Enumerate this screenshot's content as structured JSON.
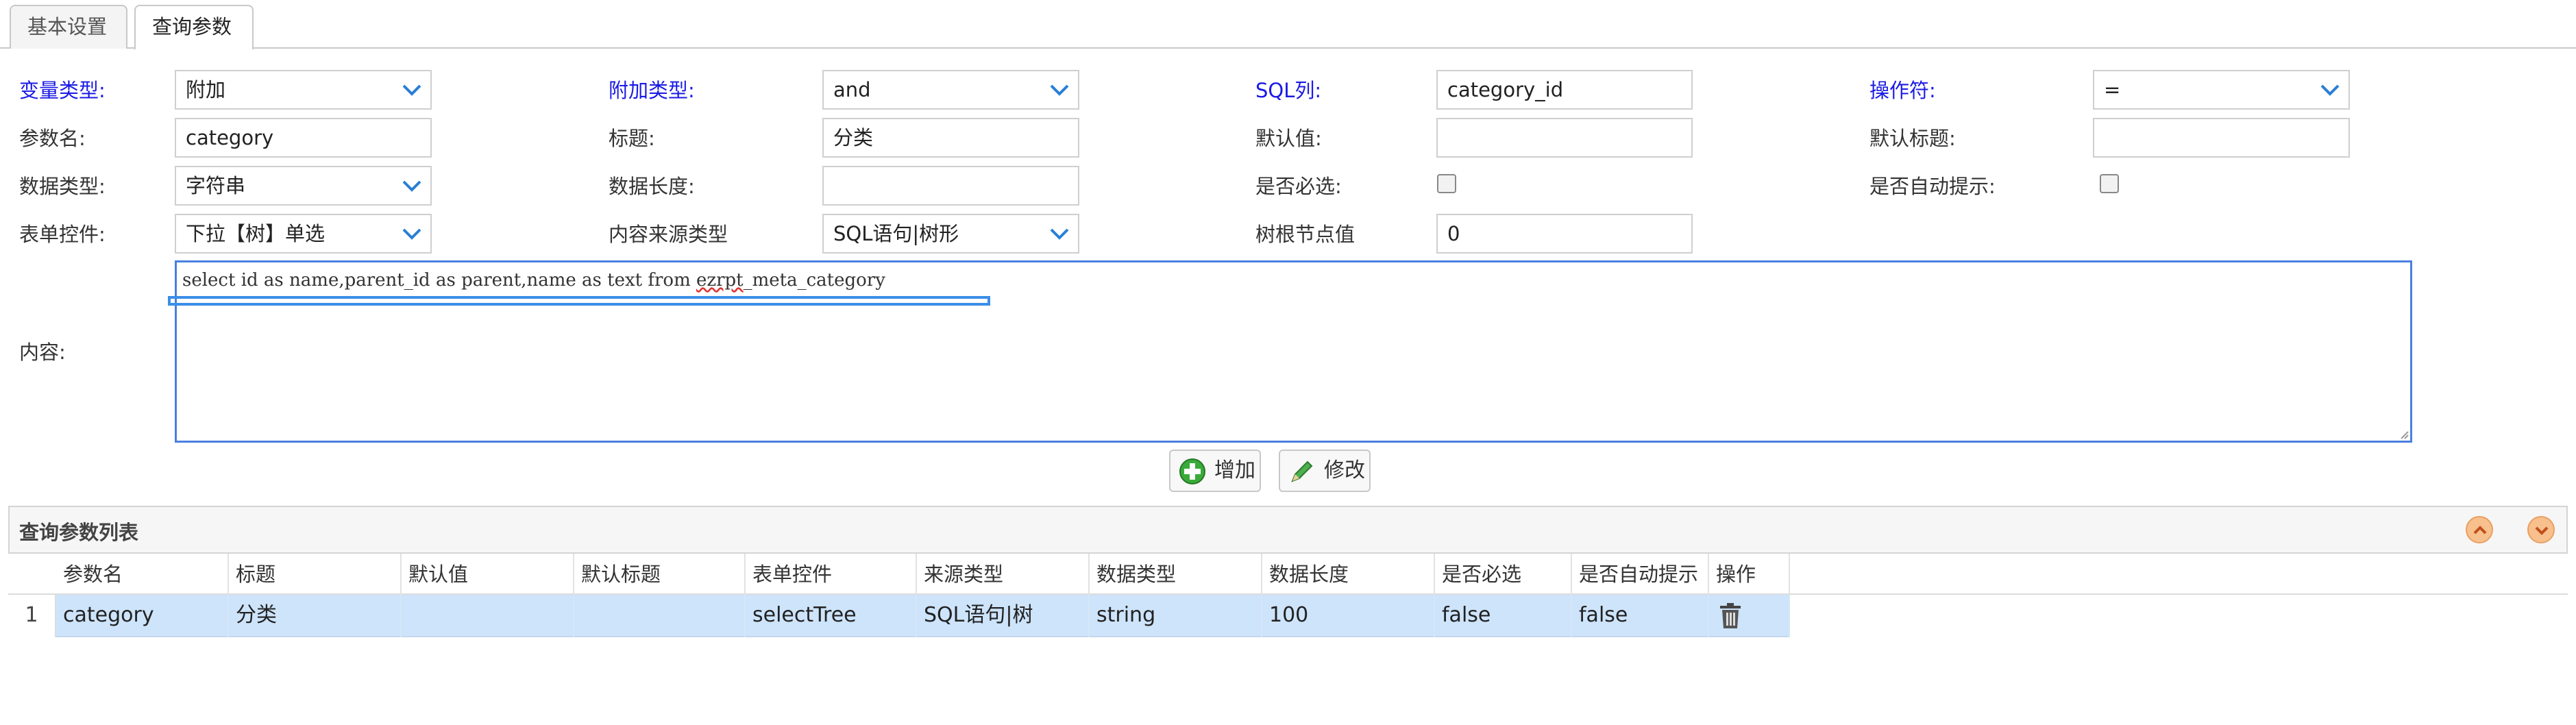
{
  "tabs": [
    {
      "label": "基本设置",
      "active": false
    },
    {
      "label": "查询参数",
      "active": true
    }
  ],
  "form": {
    "var_type": {
      "label": "变量类型:",
      "value": "附加"
    },
    "attach_type": {
      "label": "附加类型:",
      "value": "and"
    },
    "sql_col": {
      "label": "SQL列:",
      "value": "category_id"
    },
    "operator": {
      "label": "操作符:",
      "value": "="
    },
    "param_name": {
      "label": "参数名:",
      "value": "category"
    },
    "title": {
      "label": "标题:",
      "value": "分类"
    },
    "default_value": {
      "label": "默认值:",
      "value": ""
    },
    "default_title": {
      "label": "默认标题:",
      "value": ""
    },
    "data_type": {
      "label": "数据类型:",
      "value": "字符串"
    },
    "data_length": {
      "label": "数据长度:",
      "value": ""
    },
    "required": {
      "label": "是否必选:",
      "checked": false
    },
    "autocomplete": {
      "label": "是否自动提示:",
      "checked": false
    },
    "form_control": {
      "label": "表单控件:",
      "value": "下拉【树】单选"
    },
    "source_type": {
      "label": "内容来源类型",
      "value": "SQL语句|树形"
    },
    "tree_root": {
      "label": "树根节点值",
      "value": "0"
    },
    "content": {
      "label": "内容:",
      "sql_before": "select id as name,parent_id as parent,name as text from ",
      "sql_squiggle": "ezrpt",
      "sql_after": "_meta_category"
    }
  },
  "buttons": {
    "add": "增加",
    "edit": "修改"
  },
  "grid": {
    "title": "查询参数列表",
    "columns": [
      "参数名",
      "标题",
      "默认值",
      "默认标题",
      "表单控件",
      "来源类型",
      "数据类型",
      "数据长度",
      "是否必选",
      "是否自动提示",
      "操作"
    ],
    "rows": [
      {
        "num": "1",
        "cells": [
          "category",
          "分类",
          "",
          "",
          "selectTree",
          "SQL语句|树",
          "string",
          "100",
          "false",
          "false"
        ]
      }
    ]
  },
  "colors": {
    "accent_label": "#1a1ae6",
    "row_selected": "#cde4fb",
    "focus_border": "#4a7fe0"
  }
}
